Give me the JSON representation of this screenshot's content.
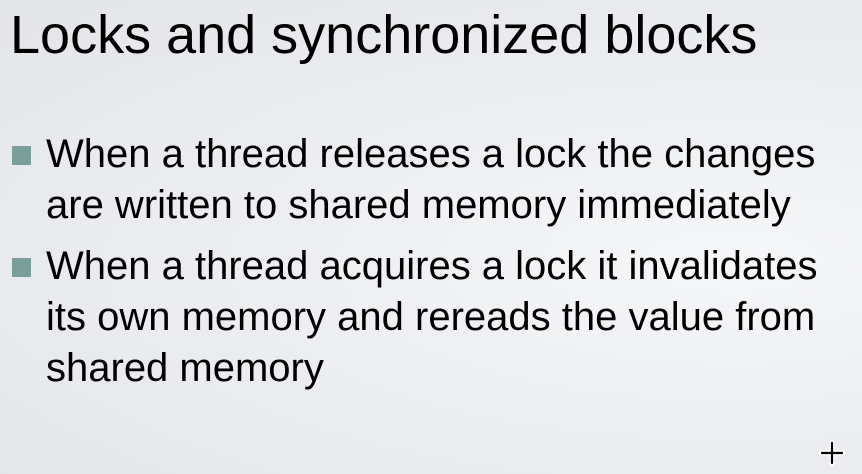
{
  "slide": {
    "title": "Locks and synchronized blocks",
    "bullets": [
      {
        "text": "When a thread releases a lock the changes are written to shared memory immediately"
      },
      {
        "text": "When a thread acquires a lock it invalidates its own memory and rereads the value from shared memory"
      }
    ]
  },
  "colors": {
    "bullet_marker": "#7a9e99",
    "text": "#000000",
    "background": "#e9ebee"
  },
  "icons": {
    "cursor": "move-crosshair-cursor-icon",
    "bullet": "square-bullet-icon"
  }
}
